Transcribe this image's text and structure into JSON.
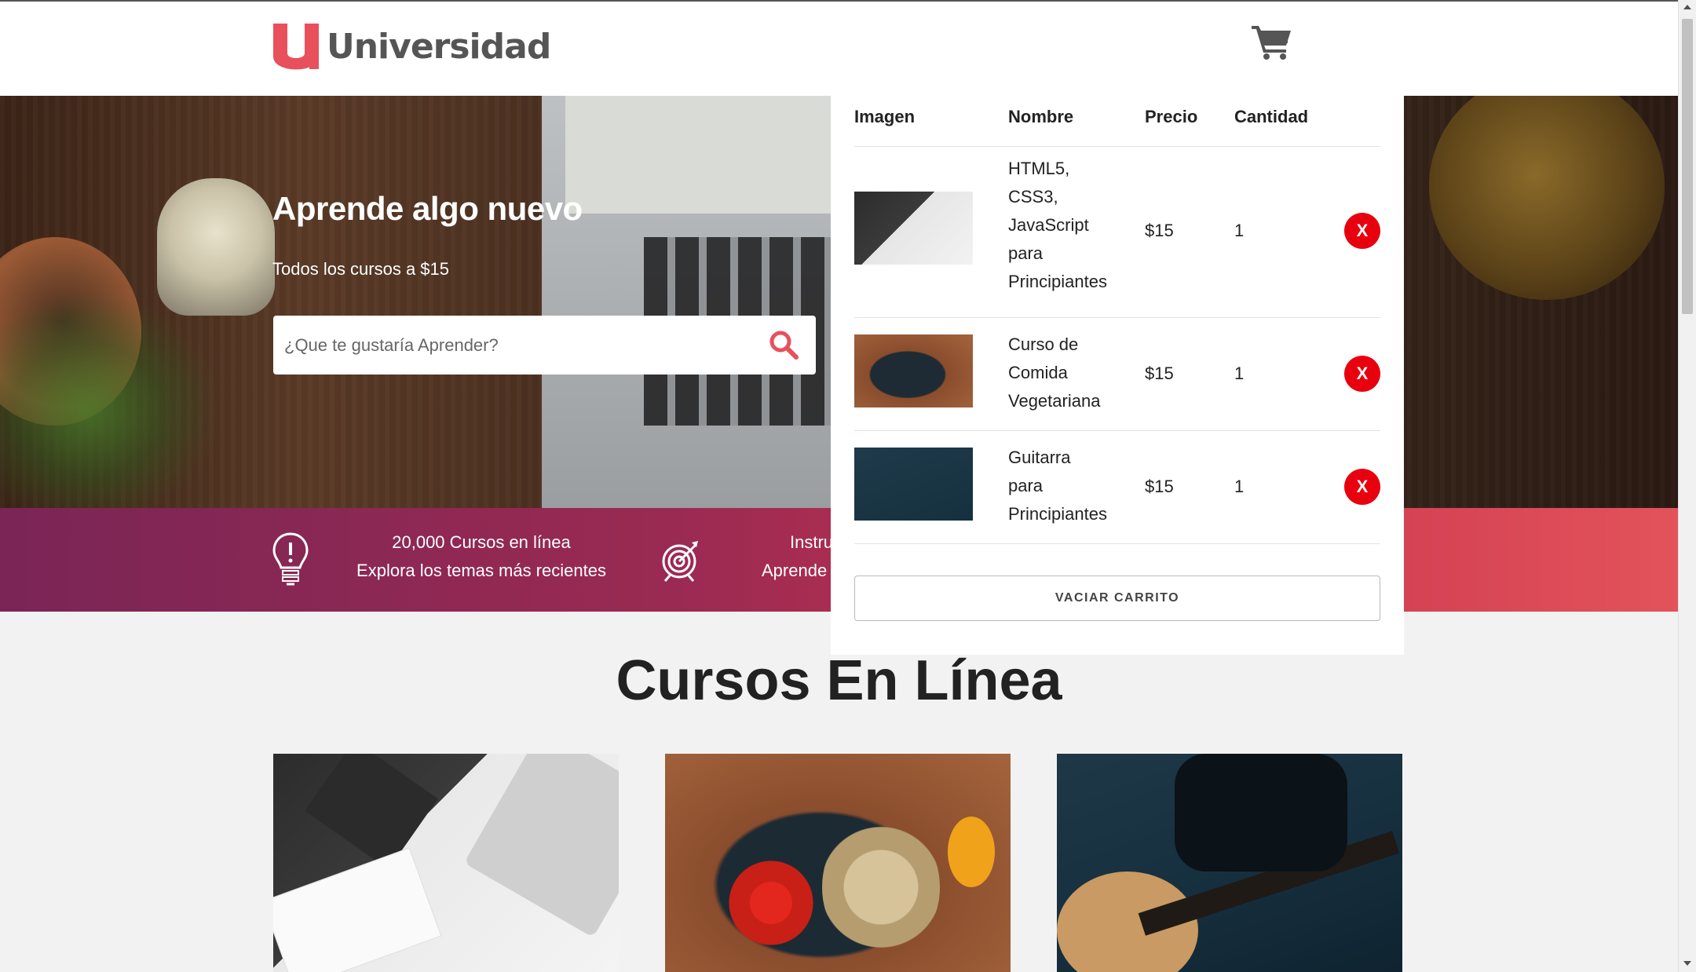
{
  "header": {
    "logo_text": "Universidad",
    "cart_icon": "shopping-cart-icon"
  },
  "hero": {
    "title": "Aprende algo nuevo",
    "subtitle": "Todos los cursos a $15",
    "search_placeholder": "¿Que te gustaría Aprender?",
    "search_icon": "search-icon"
  },
  "band": {
    "item1": {
      "icon": "lightbulb-icon",
      "line1": "20,000 Cursos en línea",
      "line2": "Explora los temas más recientes"
    },
    "item2": {
      "icon": "target-icon",
      "line1": "Instru",
      "line2": "Aprende"
    }
  },
  "section": {
    "title": "Cursos En Línea"
  },
  "cart": {
    "headers": {
      "image": "Imagen",
      "name": "Nombre",
      "price": "Precio",
      "quantity": "Cantidad"
    },
    "items": [
      {
        "name_lines": [
          "HTML5,",
          "CSS3,",
          "JavaScript",
          "para",
          "Principiantes"
        ],
        "price": "$15",
        "quantity": "1",
        "remove": "X"
      },
      {
        "name_lines": [
          "Curso de",
          "Comida",
          "Vegetariana"
        ],
        "price": "$15",
        "quantity": "1",
        "remove": "X"
      },
      {
        "name_lines": [
          "Guitarra",
          "para",
          "Principiantes"
        ],
        "price": "$15",
        "quantity": "1",
        "remove": "X"
      }
    ],
    "empty_button": "VACIAR CARRITO"
  },
  "colors": {
    "brand_red": "#e8505b",
    "band_start": "#7a2556",
    "band_end": "#e3535a",
    "remove_red": "#e8000e"
  }
}
